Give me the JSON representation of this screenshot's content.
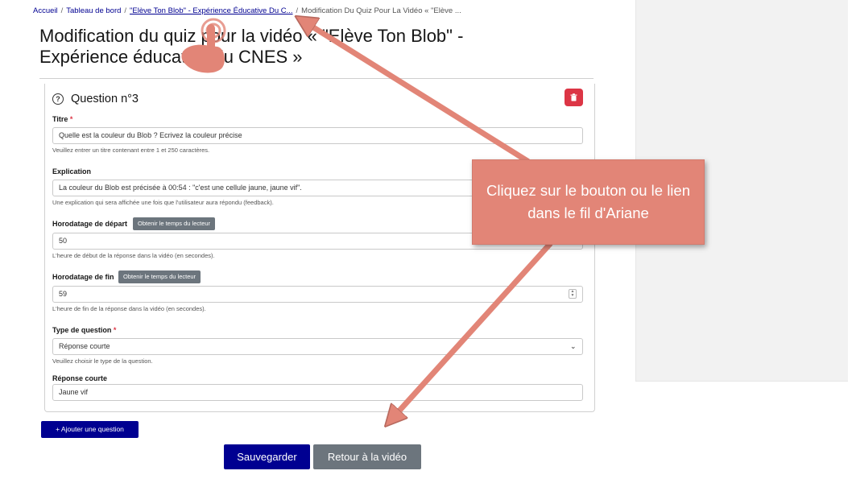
{
  "breadcrumb": {
    "home": "Accueil",
    "dashboard": "Tableau de bord",
    "video": "\"Elève Ton Blob\" - Expérience Éducative Du C...",
    "current": "Modification Du Quiz Pour La Vidéo « \"Elève ..."
  },
  "page_title": "Modification du quiz pour la vidéo « \"Elève Ton Blob\" - Expérience éducative du CNES »",
  "question": {
    "heading": "Question n°3",
    "help_icon": "question-circle-icon",
    "delete_icon": "trash-icon",
    "title": {
      "label": "Titre",
      "required": "*",
      "value": "Quelle est la couleur du Blob ? Ecrivez la couleur précise",
      "help": "Veuillez entrer un titre contenant entre 1 et 250 caractères."
    },
    "explanation": {
      "label": "Explication",
      "value": "La couleur du Blob est précisée à 00:54 : \"c'est une cellule jaune, jaune vif\".",
      "help": "Une explication qui sera affichée une fois que l'utilisateur aura répondu (feedback)."
    },
    "start_time": {
      "label": "Horodatage de départ",
      "button": "Obtenir le temps du lecteur",
      "value": "50",
      "help": "L'heure de début de la réponse dans la vidéo (en secondes)."
    },
    "end_time": {
      "label": "Horodatage de fin",
      "button": "Obtenir le temps du lecteur",
      "value": "59",
      "help": "L'heure de fin de la réponse dans la vidéo (en secondes)."
    },
    "question_type": {
      "label": "Type de question",
      "required": "*",
      "selected": "Réponse courte",
      "help": "Veuillez choisir le type de la question."
    },
    "short_answer": {
      "label": "Réponse courte",
      "value": "Jaune vif"
    }
  },
  "actions": {
    "add_question": "+ Ajouter une question",
    "save": "Sauvegarder",
    "back": "Retour à la vidéo"
  },
  "tutorial": {
    "callout_text": "Cliquez sur le bouton ou le lien dans le fil d'Ariane",
    "accent_color": "#e28577"
  }
}
